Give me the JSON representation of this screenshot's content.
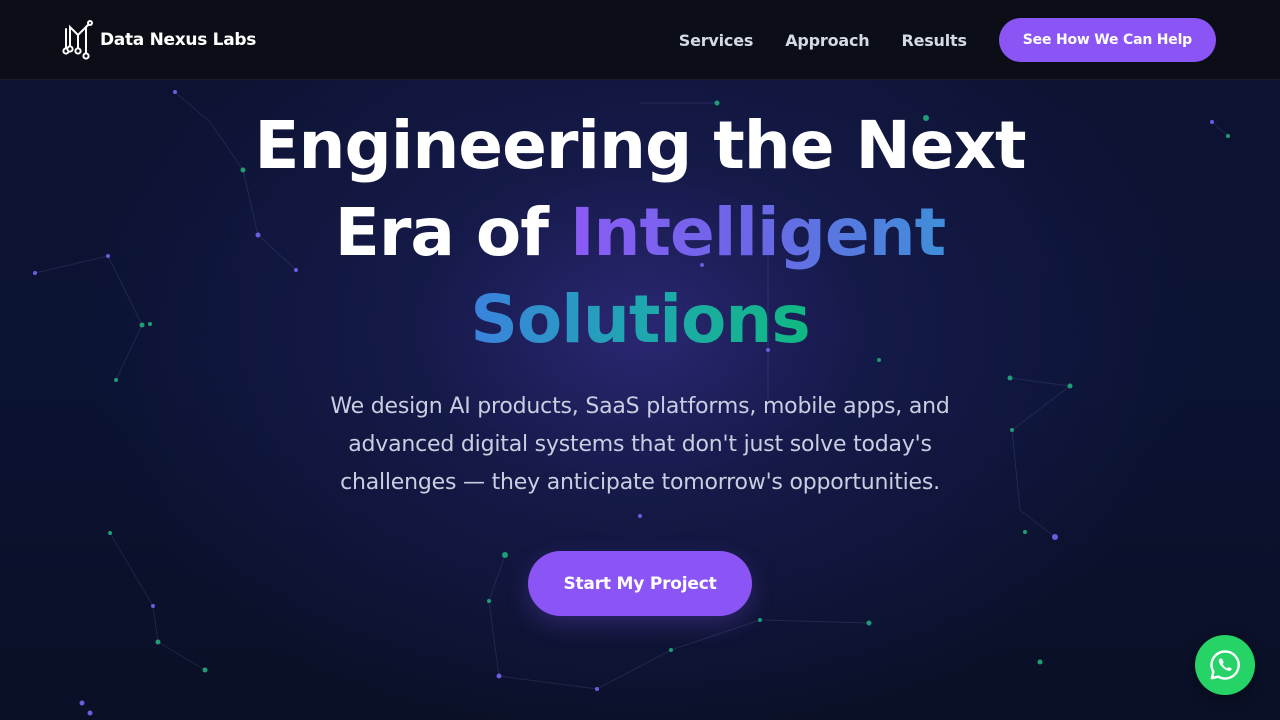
{
  "header": {
    "brand_name": "Data Nexus Labs",
    "logo_icon": "circuit-logo-icon",
    "nav": [
      {
        "label": "Services"
      },
      {
        "label": "Approach"
      },
      {
        "label": "Results"
      }
    ],
    "cta_label": "See How We Can Help"
  },
  "hero": {
    "title_line1": "Engineering the Next",
    "title_line2_plain": "Era of ",
    "title_line2_highlight": "Intelligent",
    "title_line3_highlight": "Solutions",
    "subtitle_line1": "We design AI products, SaaS platforms, mobile apps, and",
    "subtitle_line2": "advanced digital systems that don't just solve today's",
    "subtitle_line3": "challenges — they anticipate tomorrow's opportunities.",
    "cta_label": "Start My Project"
  },
  "chat_widget": {
    "icon": "whatsapp-icon",
    "color": "#25d366"
  },
  "colors": {
    "accent": "#8b55f6",
    "header_bg": "#0b0d17",
    "page_bg": "#0b1333",
    "gradient_purple": "#8b5cf6",
    "gradient_blue": "#3f8fd9",
    "gradient_green": "#10b981"
  }
}
